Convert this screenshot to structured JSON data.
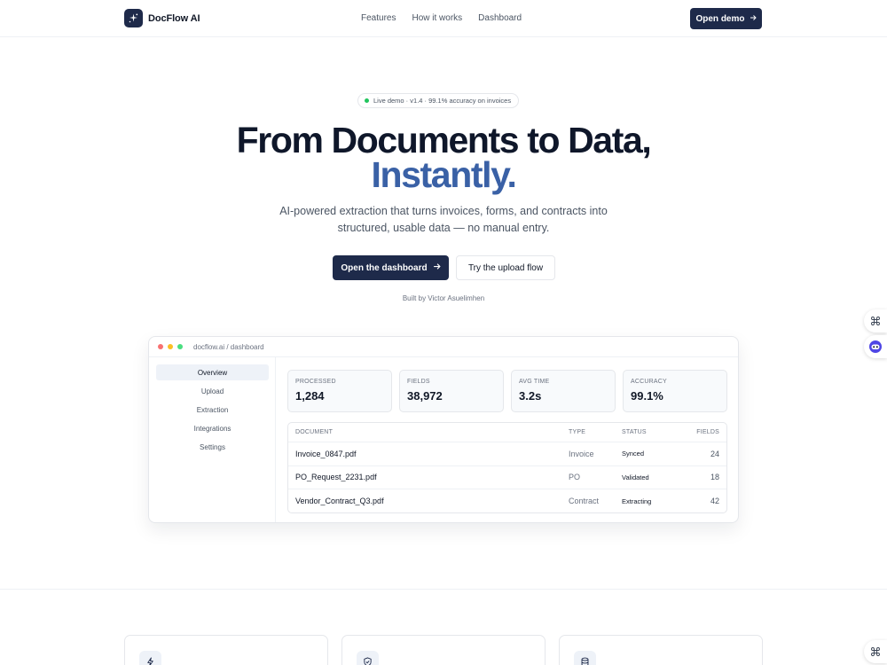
{
  "nav": {
    "brand": "DocFlow AI",
    "links": [
      "Features",
      "How it works",
      "Dashboard"
    ],
    "cta": "Open demo"
  },
  "hero": {
    "badge": "Live demo · v1.4 · 99.1% accuracy on invoices",
    "title_line1": "From Documents to Data,",
    "title_line2": "Instantly",
    "title_line2_punct": ".",
    "subtitle_line1": "AI-powered extraction that turns invoices, forms, and contracts into",
    "subtitle_line2": "structured, usable data — no manual entry.",
    "primary_cta": "Open the dashboard",
    "secondary_cta": "Try the upload flow",
    "credit": "Built by Victor Asuelimhen"
  },
  "dashboard": {
    "url": "docflow.ai / dashboard",
    "sidebar": [
      "Overview",
      "Upload",
      "Extraction",
      "Integrations",
      "Settings"
    ],
    "stats": [
      {
        "label": "PROCESSED",
        "value": "1,284"
      },
      {
        "label": "FIELDS",
        "value": "38,972"
      },
      {
        "label": "AVG TIME",
        "value": "3.2s"
      },
      {
        "label": "ACCURACY",
        "value": "99.1%"
      }
    ],
    "table": {
      "headers": [
        "DOCUMENT",
        "TYPE",
        "STATUS",
        "FIELDS"
      ],
      "rows": [
        [
          "Invoice_0847.pdf",
          "Invoice",
          "Synced",
          "24"
        ],
        [
          "PO_Request_2231.pdf",
          "PO",
          "Validated",
          "18"
        ],
        [
          "Vendor_Contract_Q3.pdf",
          "Contract",
          "Extracting",
          "42"
        ]
      ]
    }
  },
  "colors": {
    "brand_navy": "#1e2a4a",
    "accent_blue": "#3a61a6",
    "live_green": "#22c55e"
  },
  "icons": {
    "brand": "sparkle-icon",
    "cta_arrow": "arrow-right-icon",
    "feature_1": "lightning-icon",
    "feature_2": "shield-check-icon",
    "feature_3": "database-icon",
    "fab_top": "command-icon",
    "fab_assistant": "assistant-face-icon",
    "fab_bottom": "command-icon"
  }
}
